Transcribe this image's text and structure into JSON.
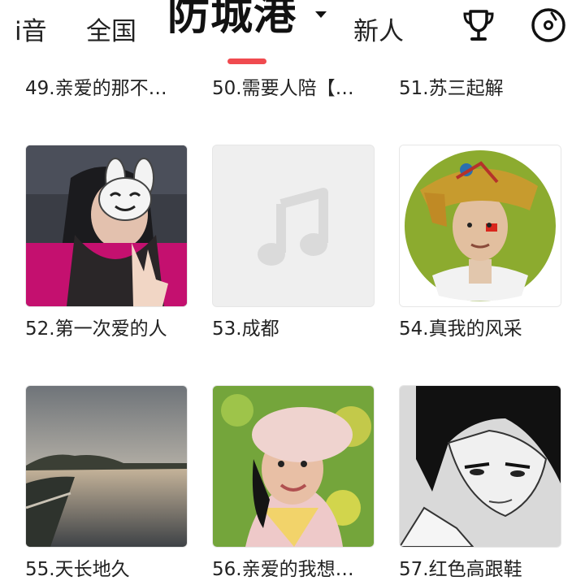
{
  "header": {
    "tabs": [
      {
        "label": "i音"
      },
      {
        "label": "全国"
      },
      {
        "label": "防城港"
      },
      {
        "label": "新人"
      }
    ],
    "trophy_icon": "trophy-icon",
    "disc_icon": "record-disc-icon",
    "accent_color": "#f04a4f"
  },
  "grid": {
    "items": [
      {
        "label": "49.亲爱的那不…"
      },
      {
        "label": "50.需要人陪【…"
      },
      {
        "label": "51.苏三起解"
      },
      {
        "label": "52.第一次爱的人",
        "image": "woman-with-cartoon-rabbit-sticker"
      },
      {
        "label": "53.成都",
        "image": "music-note-placeholder-icon"
      },
      {
        "label": "54.真我的风采",
        "image": "man-in-colorful-turban"
      },
      {
        "label": "55.天长地久",
        "image": "lake-sunset-landscape"
      },
      {
        "label": "56.亲爱的我想…",
        "image": "woman-in-white-beret"
      },
      {
        "label": "57.红色高跟鞋",
        "image": "anime-man-sketch"
      }
    ]
  }
}
